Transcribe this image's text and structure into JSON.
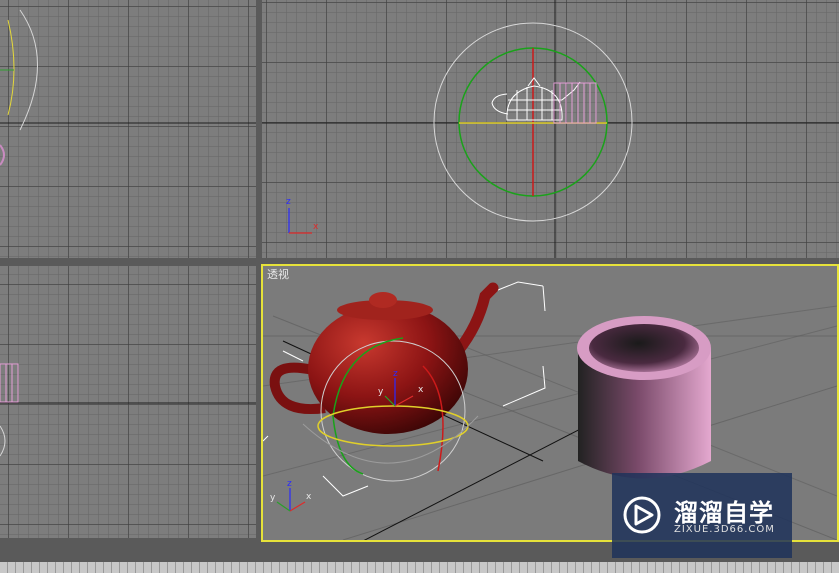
{
  "viewports": {
    "perspective_label": "透视"
  },
  "axes": {
    "z": "z",
    "x": "x",
    "y": "y"
  },
  "watermark": {
    "title": "溜溜自学",
    "url": "ZIXUE.3D66.COM"
  },
  "colors": {
    "viewport_bg": "#7d7d7d",
    "active_border": "#e6e23a",
    "teapot": "#8c1414",
    "cup": "#c07fa6"
  }
}
